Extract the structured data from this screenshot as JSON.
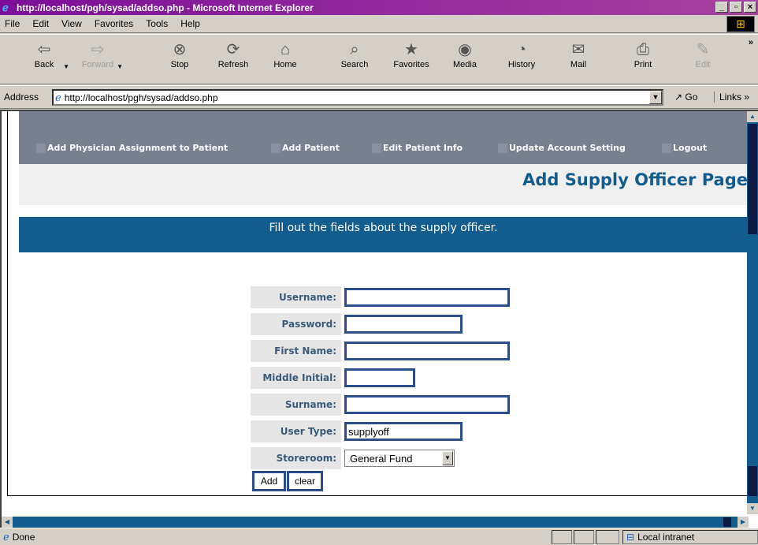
{
  "window": {
    "title": "http://localhost/pgh/sysad/addso.php - Microsoft Internet Explorer",
    "minimize": "_",
    "maximize": "▫",
    "close": "×"
  },
  "menu": [
    "File",
    "Edit",
    "View",
    "Favorites",
    "Tools",
    "Help"
  ],
  "toolbar": {
    "buttons": [
      {
        "label": "Back",
        "icon": "back-arrow-icon",
        "glyph": "⇦",
        "enabled": true
      },
      {
        "label": "Forward",
        "icon": "forward-arrow-icon",
        "glyph": "⇨",
        "enabled": false
      },
      {
        "label": "Stop",
        "icon": "stop-icon",
        "glyph": "⊗",
        "enabled": true
      },
      {
        "label": "Refresh",
        "icon": "refresh-icon",
        "glyph": "⟳",
        "enabled": true
      },
      {
        "label": "Home",
        "icon": "home-icon",
        "glyph": "⌂",
        "enabled": true
      },
      {
        "label": "Search",
        "icon": "search-icon",
        "glyph": "⌕",
        "enabled": true
      },
      {
        "label": "Favorites",
        "icon": "favorites-icon",
        "glyph": "★",
        "enabled": true
      },
      {
        "label": "Media",
        "icon": "media-icon",
        "glyph": "◉",
        "enabled": true
      },
      {
        "label": "History",
        "icon": "history-icon",
        "glyph": "◔",
        "enabled": true
      },
      {
        "label": "Mail",
        "icon": "mail-icon",
        "glyph": "✉",
        "enabled": true
      },
      {
        "label": "Print",
        "icon": "print-icon",
        "glyph": "⎙",
        "enabled": true
      },
      {
        "label": "Edit",
        "icon": "edit-icon",
        "glyph": "✎",
        "enabled": false
      }
    ],
    "overflow": "»"
  },
  "address": {
    "label": "Address",
    "url": "http://localhost/pgh/sysad/addso.php",
    "go": "Go",
    "links": "Links »"
  },
  "nav": {
    "links": [
      "Add Physician Assignment to Patient",
      "Add Patient",
      "Edit Patient Info",
      "Update Account Setting",
      "Logout"
    ]
  },
  "page": {
    "title": "Add Supply Officer Page",
    "instructions": "Fill out the fields about the supply officer."
  },
  "form": {
    "fields": [
      {
        "label": "Username:",
        "value": ""
      },
      {
        "label": "Password:",
        "value": ""
      },
      {
        "label": "First Name:",
        "value": ""
      },
      {
        "label": "Middle Initial:",
        "value": ""
      },
      {
        "label": "Surname:",
        "value": ""
      },
      {
        "label": "User Type:",
        "value": "supplyoff"
      },
      {
        "label": "Storeroom:",
        "value": "General Fund"
      }
    ],
    "add_label": "Add",
    "clear_label": "clear"
  },
  "status": {
    "text": "Done",
    "zone": "Local intranet"
  },
  "colors": {
    "nav_bg": "#788090",
    "brand_blue": "#125d8d",
    "input_border": "#2c4a8e"
  }
}
